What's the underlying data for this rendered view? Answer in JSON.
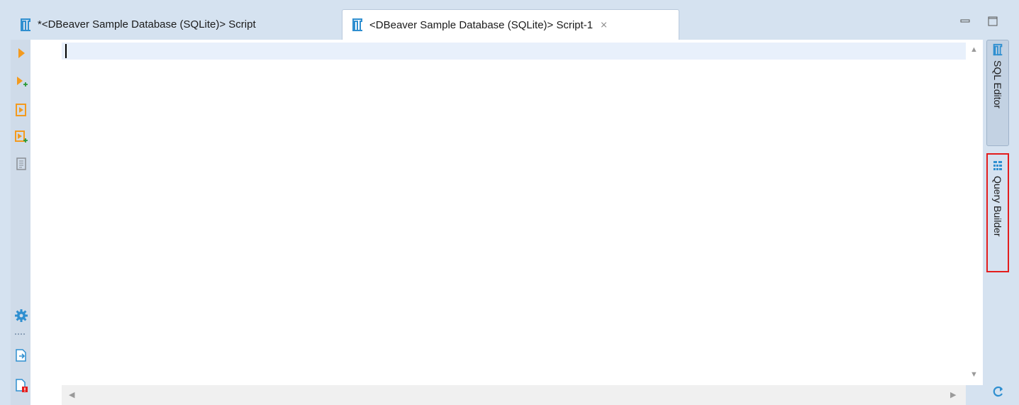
{
  "tabs": [
    {
      "label": "*<DBeaver Sample Database (SQLite)> Script",
      "icon": "sql-script-icon",
      "active": false
    },
    {
      "label": "<DBeaver Sample Database (SQLite)> Script-1",
      "icon": "sql-script-icon",
      "active": true,
      "close": "⨯"
    }
  ],
  "window_controls": {
    "minimize": "minimize-icon",
    "maximize": "maximize-icon"
  },
  "toolbar": [
    {
      "name": "execute-statement-icon"
    },
    {
      "name": "execute-statement-new-tab-icon"
    },
    {
      "name": "execute-script-icon"
    },
    {
      "name": "execute-script-new-tab-icon"
    },
    {
      "name": "explain-plan-icon"
    },
    {
      "name": "settings-icon"
    },
    {
      "name": "export-icon"
    },
    {
      "name": "problems-icon"
    }
  ],
  "editor": {
    "content": ""
  },
  "right_tabs": [
    {
      "label": "SQL Editor",
      "icon": "sql-editor-icon",
      "active": true
    },
    {
      "label": "Query Builder",
      "icon": "query-builder-icon",
      "active": false,
      "highlighted": true
    }
  ],
  "colors": {
    "accent": "#f39a1e",
    "tab_icon": "#2f8fd0",
    "highlight_border": "#e31d1d",
    "background": "#d5e2f0"
  }
}
